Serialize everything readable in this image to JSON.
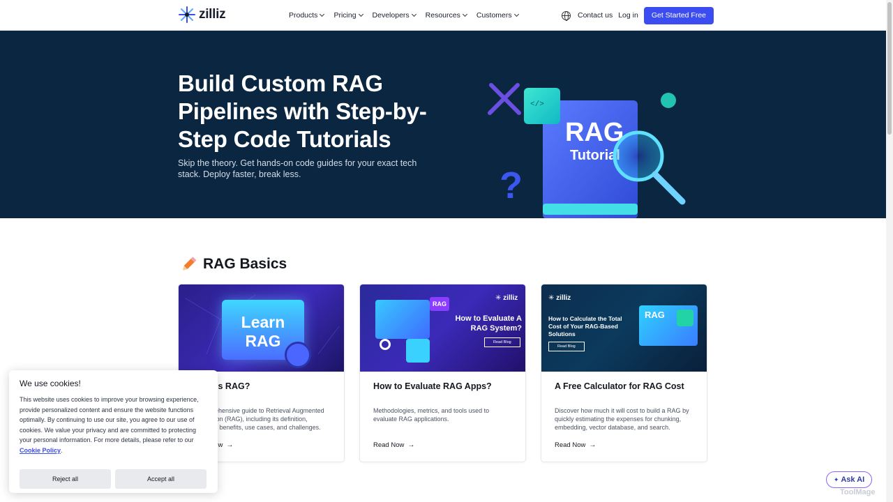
{
  "nav": {
    "logo": "zilliz",
    "menu": [
      {
        "label": "Products"
      },
      {
        "label": "Pricing"
      },
      {
        "label": "Developers"
      },
      {
        "label": "Resources"
      },
      {
        "label": "Customers"
      }
    ],
    "contact": "Contact us",
    "login": "Log in",
    "cta": "Get Started Free"
  },
  "hero": {
    "title": "Build Custom RAG Pipelines with Step-by-Step Code Tutorials",
    "subtitle": "Skip the theory. Get hands-on code guides for your exact tech stack. Deploy faster, break less.",
    "book_title": "RAG",
    "book_subtitle": "Tutorial",
    "code_glyph": "</>"
  },
  "section": {
    "title": "RAG Basics",
    "icon": "pencil-icon"
  },
  "cards": [
    {
      "image_title_line1": "Learn",
      "image_title_line2": "RAG",
      "title": "What is RAG?",
      "description": "A comprehensive guide to Retrieval Augmented Generation (RAG), including its definition, workflow, benefits, use cases, and challenges.",
      "read": "Read Now"
    },
    {
      "image_badge": "RAG",
      "image_logo": "zilliz",
      "image_heading": "How to Evaluate A RAG System?",
      "image_button": "Read Blog",
      "title": "How to Evaluate RAG Apps?",
      "description": "Methodologies, metrics, and tools used to evaluate RAG applications.",
      "read": "Read Now"
    },
    {
      "image_logo": "zilliz",
      "image_heading": "How to Calculate the Total Cost of Your RAG-Based Solutions",
      "image_button": "Read Blog",
      "image_badge": "RAG",
      "title": "A Free Calculator for RAG Cost",
      "description": "Discover how much it will cost to build a RAG by quickly estimating the expenses for chunking, embedding, vector database, and search.",
      "read": "Read Now"
    }
  ],
  "cookie": {
    "title": "We use cookies!",
    "body": "This website uses cookies to improve your browsing experience, provide personalized content and ensure the website functions optimally. By continuing to use our site, you agree to our use of cookies. We value your privacy and are committed to protecting your personal information. For more details, please refer to our ",
    "link": "Cookie Policy",
    "period": ".",
    "reject": "Reject all",
    "accept": "Accept all"
  },
  "ask_ai": "Ask AI",
  "watermark": "ToolMage",
  "colors": {
    "brand": "#3b4cf0",
    "hero_bg": "#0b2640",
    "accent": "#8a63ff"
  }
}
